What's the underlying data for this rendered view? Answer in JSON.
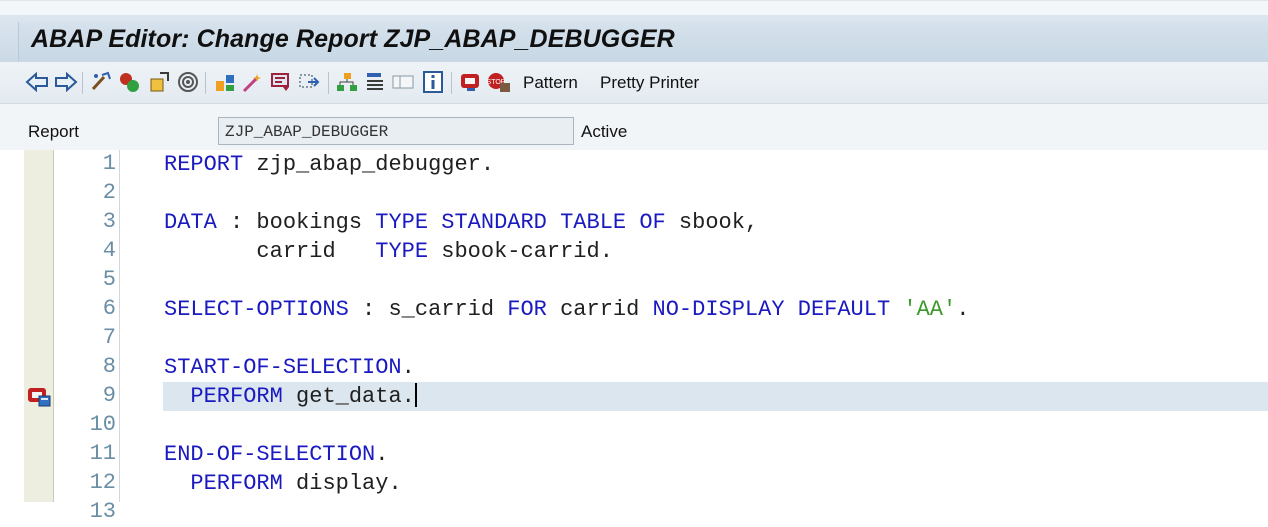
{
  "window": {
    "title": "ABAP Editor: Change Report ZJP_ABAP_DEBUGGER"
  },
  "toolbar": {
    "icons": [
      "back-arrow-icon",
      "forward-arrow-icon",
      "toggle-display-change-icon",
      "active-inactive-icon",
      "check-object-icon",
      "activate-icon",
      "test-icon",
      "where-used-icon",
      "object-list-icon",
      "display-navigation-icon",
      "object-window-icon",
      "hierarchy-icon",
      "pattern-list-icon",
      "info-icon",
      "set-breakpoint-icon",
      "set-session-breakpoint-icon"
    ],
    "pattern_label": "Pattern",
    "pretty_printer_label": "Pretty Printer"
  },
  "header": {
    "report_label": "Report",
    "report_value": "ZJP_ABAP_DEBUGGER",
    "status": "Active"
  },
  "editor": {
    "lines": [
      {
        "num": "1",
        "code": "REPORT zjp_abap_debugger."
      },
      {
        "num": "2",
        "code": ""
      },
      {
        "num": "3",
        "code": "DATA : bookings TYPE STANDARD TABLE OF sbook,"
      },
      {
        "num": "4",
        "code": "       carrid   TYPE sbook-carrid."
      },
      {
        "num": "5",
        "code": ""
      },
      {
        "num": "6",
        "code": "SELECT-OPTIONS : s_carrid FOR carrid NO-DISPLAY DEFAULT 'AA'."
      },
      {
        "num": "7",
        "code": ""
      },
      {
        "num": "8",
        "code": "START-OF-SELECTION."
      },
      {
        "num": "9",
        "code": "  PERFORM get_data.",
        "breakpoint": true,
        "current": true
      },
      {
        "num": "10",
        "code": ""
      },
      {
        "num": "11",
        "code": "END-OF-SELECTION."
      },
      {
        "num": "12",
        "code": "  PERFORM display."
      },
      {
        "num": "13",
        "code": ""
      }
    ],
    "keywords": [
      "REPORT",
      "DATA",
      "TYPE",
      "STANDARD",
      "TABLE",
      "OF",
      "SELECT-OPTIONS",
      "FOR",
      "NO-DISPLAY",
      "DEFAULT",
      "START-OF-SELECTION",
      "PERFORM",
      "END-OF-SELECTION"
    ]
  },
  "colors": {
    "keyword": "#1a1ac0",
    "string": "#3c9a2c",
    "line_number": "#6a8ea6",
    "current_line": "#dbe6ef"
  }
}
